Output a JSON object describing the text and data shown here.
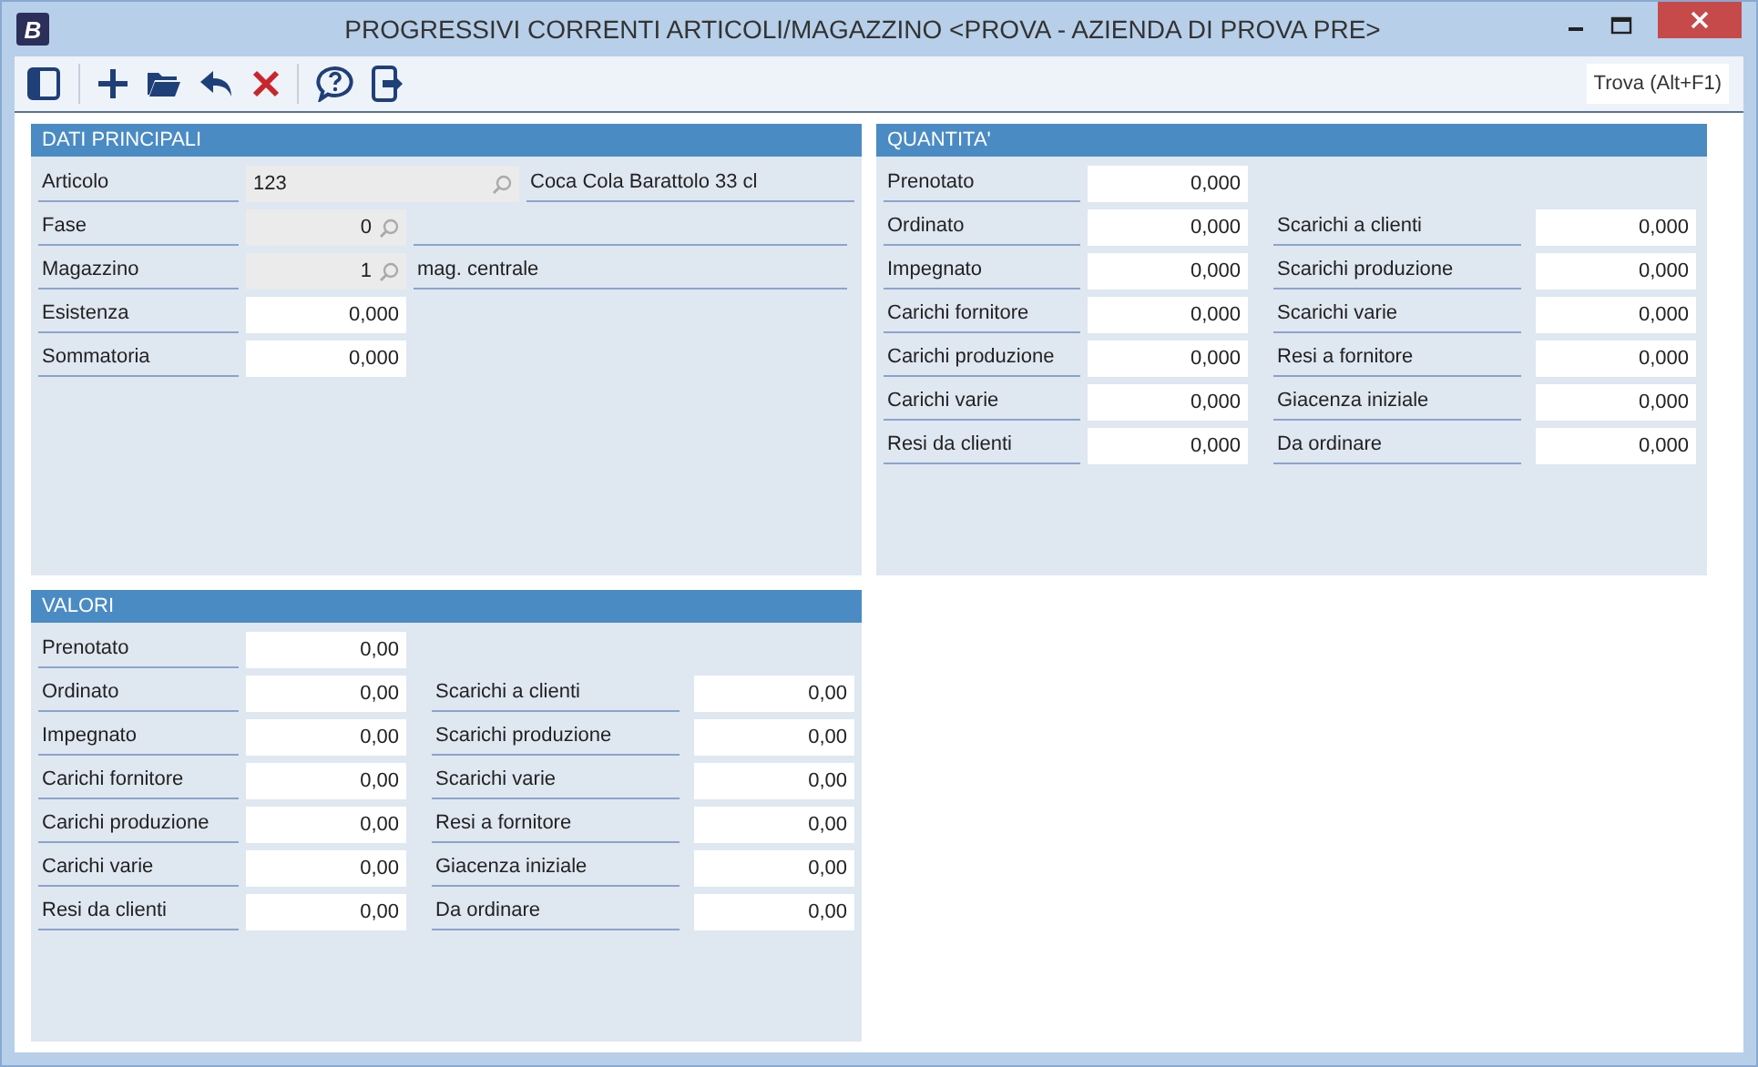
{
  "window": {
    "logo": "B",
    "title": "PROGRESSIVI CORRENTI ARTICOLI/MAGAZZINO <PROVA - AZIENDA DI PROVA PRE>"
  },
  "toolbar": {
    "search": "Trova (Alt+F1)"
  },
  "dati_principali": {
    "title": "DATI PRINCIPALI",
    "fields": [
      {
        "kind": "code",
        "label": "Articolo",
        "value": "123",
        "description": "Coca Cola Barattolo 33 cl"
      },
      {
        "kind": "lookup",
        "label": "Fase",
        "value": "0"
      },
      {
        "kind": "lookup",
        "label": "Magazzino",
        "value": "1",
        "description": "mag. centrale"
      },
      {
        "kind": "number",
        "label": "Esistenza",
        "value": "0,000"
      },
      {
        "kind": "number",
        "label": "Sommatoria",
        "value": "0,000"
      }
    ]
  },
  "quantita": {
    "title": "QUANTITA'",
    "rows": [
      {
        "left": {
          "label": "Prenotato",
          "value": "0,000"
        }
      },
      {
        "left": {
          "label": "Ordinato",
          "value": "0,000"
        },
        "right": {
          "label": "Scarichi a clienti",
          "value": "0,000"
        }
      },
      {
        "left": {
          "label": "Impegnato",
          "value": "0,000"
        },
        "right": {
          "label": "Scarichi produzione",
          "value": "0,000"
        }
      },
      {
        "left": {
          "label": "Carichi fornitore",
          "value": "0,000"
        },
        "right": {
          "label": "Scarichi varie",
          "value": "0,000"
        }
      },
      {
        "left": {
          "label": "Carichi produzione",
          "value": "0,000"
        },
        "right": {
          "label": "Resi a fornitore",
          "value": "0,000"
        }
      },
      {
        "left": {
          "label": "Carichi varie",
          "value": "0,000"
        },
        "right": {
          "label": "Giacenza iniziale",
          "value": "0,000"
        }
      },
      {
        "left": {
          "label": "Resi da clienti",
          "value": "0,000"
        },
        "right": {
          "label": "Da ordinare",
          "value": "0,000"
        }
      }
    ]
  },
  "valori": {
    "title": "VALORI",
    "rows": [
      {
        "left": {
          "label": "Prenotato",
          "value": "0,00"
        }
      },
      {
        "left": {
          "label": "Ordinato",
          "value": "0,00"
        },
        "right": {
          "label": "Scarichi a clienti",
          "value": "0,00"
        }
      },
      {
        "left": {
          "label": "Impegnato",
          "value": "0,00"
        },
        "right": {
          "label": "Scarichi produzione",
          "value": "0,00"
        }
      },
      {
        "left": {
          "label": "Carichi fornitore",
          "value": "0,00"
        },
        "right": {
          "label": "Scarichi varie",
          "value": "0,00"
        }
      },
      {
        "left": {
          "label": "Carichi produzione",
          "value": "0,00"
        },
        "right": {
          "label": "Resi a fornitore",
          "value": "0,00"
        }
      },
      {
        "left": {
          "label": "Carichi varie",
          "value": "0,00"
        },
        "right": {
          "label": "Giacenza iniziale",
          "value": "0,00"
        }
      },
      {
        "left": {
          "label": "Resi da clienti",
          "value": "0,00"
        },
        "right": {
          "label": "Da ordinare",
          "value": "0,00"
        }
      }
    ]
  }
}
